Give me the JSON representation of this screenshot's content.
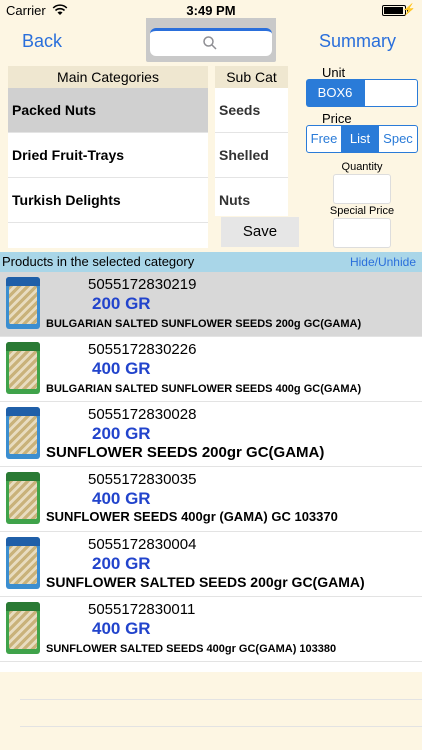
{
  "status_bar": {
    "carrier": "Carrier",
    "time": "3:49 PM"
  },
  "nav": {
    "back_label": "Back",
    "summary_label": "Summary",
    "search_placeholder": ""
  },
  "main_categories": {
    "header": "Main Categories",
    "items": [
      {
        "label": "Packed Nuts",
        "selected": true
      },
      {
        "label": "Dried Fruit-Trays",
        "selected": false
      },
      {
        "label": "Turkish Delights",
        "selected": false
      }
    ]
  },
  "sub_categories": {
    "header": "Sub Cat",
    "items": [
      {
        "label": "Seeds"
      },
      {
        "label": "Shelled"
      },
      {
        "label": "Nuts"
      }
    ]
  },
  "save_label": "Save",
  "unit": {
    "label": "Unit",
    "options": [
      "BOX6",
      ""
    ],
    "selected": "BOX6"
  },
  "price": {
    "label": "Price",
    "options": [
      "Free",
      "List",
      "Spec"
    ],
    "selected": "List"
  },
  "quantity_label": "Quantity",
  "special_price_label": "Special Price",
  "products": {
    "header": "Products in the selected category",
    "hide_label": "Hide/Unhide",
    "items": [
      {
        "barcode": "5055172830219",
        "size": "200 GR",
        "name": "BULGARIAN SALTED SUNFLOWER SEEDS 200g GC(GAMA)",
        "thumb": "blue",
        "selected": true
      },
      {
        "barcode": "5055172830226",
        "size": "400 GR",
        "name": "BULGARIAN SALTED SUNFLOWER SEEDS 400g GC(GAMA)",
        "thumb": "green",
        "selected": false
      },
      {
        "barcode": "5055172830028",
        "size": "200 GR",
        "name": "SUNFLOWER SEEDS 200gr GC(GAMA)",
        "thumb": "blue",
        "selected": false
      },
      {
        "barcode": "5055172830035",
        "size": "400 GR",
        "name": "SUNFLOWER SEEDS 400gr (GAMA) GC  103370",
        "thumb": "green",
        "selected": false
      },
      {
        "barcode": "5055172830004",
        "size": "200 GR",
        "name": "SUNFLOWER SALTED SEEDS 200gr GC(GAMA)",
        "thumb": "blue",
        "selected": false
      },
      {
        "barcode": "5055172830011",
        "size": "400 GR",
        "name": "SUNFLOWER SALTED SEEDS 400gr GC(GAMA)  103380",
        "thumb": "green",
        "selected": false
      }
    ]
  },
  "colors": {
    "accent": "#2a7bd8",
    "size_text": "#2244cc",
    "header_band": "#a9d6e8",
    "panel_bg": "#fdf6e3"
  }
}
